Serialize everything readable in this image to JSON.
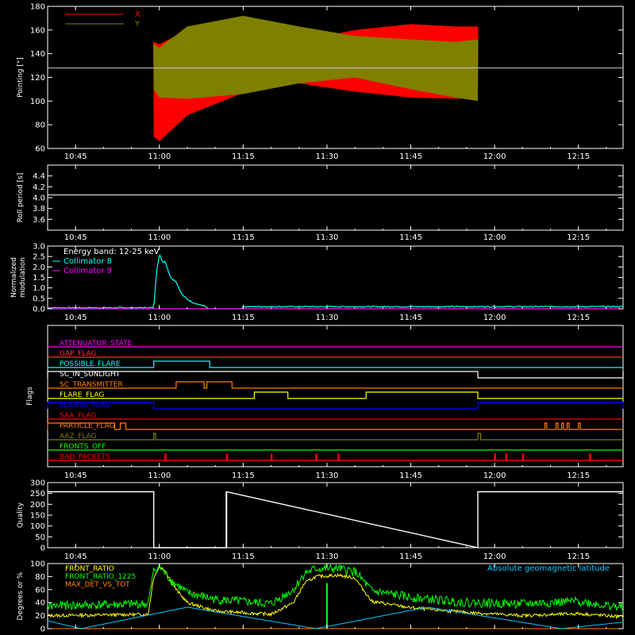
{
  "chart_data": [
    {
      "type": "line",
      "panel": "pointing",
      "ylabel": "Pointing [°]",
      "ylim": [
        60,
        180
      ],
      "yticks": [
        "60",
        "80",
        "100",
        "120",
        "140",
        "160",
        "180"
      ],
      "xticks": [
        "10:45",
        "11:00",
        "11:15",
        "11:30",
        "11:45",
        "12:00",
        "12:15"
      ],
      "legend": [
        "X",
        "Y"
      ],
      "reference_value": 128,
      "colors": {
        "X": "#ff0000",
        "Y": "#808000",
        "reference": "#c8c8c8"
      },
      "series": [
        {
          "name": "X",
          "x": [
            "10:59",
            "11:00",
            "11:05",
            "11:15",
            "11:25",
            "11:35",
            "11:45",
            "11:53",
            "11:57"
          ],
          "upper": [
            150,
            148,
            160,
            152,
            150,
            160,
            165,
            163,
            163
          ],
          "lower": [
            70,
            66,
            88,
            107,
            115,
            108,
            103,
            102,
            103
          ]
        },
        {
          "name": "Y",
          "x": [
            "10:59",
            "11:00",
            "11:05",
            "11:15",
            "11:25",
            "11:35",
            "11:45",
            "11:53",
            "11:57"
          ],
          "upper": [
            148,
            145,
            163,
            172,
            163,
            155,
            152,
            150,
            152
          ],
          "lower": [
            110,
            103,
            102,
            106,
            115,
            120,
            110,
            103,
            100
          ]
        }
      ]
    },
    {
      "type": "line",
      "panel": "roll",
      "ylabel": "Roll period [s]",
      "ylim": [
        3.4,
        4.6
      ],
      "yticks": [
        "3.6",
        "3.8",
        "4.0",
        "4.2",
        "4.4"
      ],
      "xticks": [
        "10:45",
        "11:00",
        "11:15",
        "11:30",
        "11:45",
        "12:00",
        "12:15"
      ],
      "value": 4.05
    },
    {
      "type": "line",
      "panel": "modulation",
      "ylabel": "Normalized modulation",
      "ylabel_lines": [
        "Normalized",
        "modulation"
      ],
      "ylim": [
        0,
        3
      ],
      "yticks": [
        "0.0",
        "0.5",
        "1.0",
        "1.5",
        "2.0",
        "2.5",
        "3.0"
      ],
      "xticks": [
        "10:45",
        "11:00",
        "11:15",
        "11:30",
        "11:45",
        "12:00",
        "12:15"
      ],
      "legend": [
        "Energy band: 12-25 keV",
        "Collimator 8",
        "Collimator 9"
      ],
      "colors": {
        "Collimator 8": "#00ffff",
        "Collimator 9": "#ff00ff"
      },
      "series": [
        {
          "name": "Collimator 8",
          "x": [
            "10:40",
            "10:59",
            "10:59:30",
            "11:00",
            "11:00:40",
            "11:01",
            "11:02",
            "11:03",
            "11:04",
            "11:05",
            "11:06",
            "11:07",
            "11:08",
            "11:08:40",
            "11:14:40",
            "11:15",
            "11:30",
            "11:45",
            "12:00",
            "12:15",
            "12:23"
          ],
          "y": [
            0.05,
            0.05,
            1.8,
            2.6,
            2.2,
            2.3,
            1.5,
            1.3,
            0.7,
            0.45,
            0.3,
            0.2,
            0.15,
            0.0,
            0.0,
            0.1,
            0.1,
            0.1,
            0.1,
            0.1,
            0.1
          ]
        },
        {
          "name": "Collimator 9",
          "x": [
            "10:40",
            "12:23"
          ],
          "y": [
            0.0,
            0.0
          ]
        }
      ]
    },
    {
      "type": "line",
      "panel": "flags",
      "ylabel": "Flags",
      "xticks": [
        "10:45",
        "11:00",
        "11:15",
        "11:30",
        "11:45",
        "12:00",
        "12:15"
      ],
      "flags": [
        {
          "name": "ATTENUATOR_STATE",
          "color": "#ff00ff",
          "on": []
        },
        {
          "name": "GAP_FLAG",
          "color": "#ff3030",
          "on": []
        },
        {
          "name": "POSSIBLE_FLARE",
          "color": "#00ffff",
          "on": [
            [
              "10:59",
              "11:09"
            ]
          ]
        },
        {
          "name": "SC_IN_SUNLIGHT",
          "color": "#ffffff",
          "on": [
            [
              "10:40",
              "11:57"
            ],
            [
              "12:23",
              "12:23"
            ]
          ],
          "inverted": true
        },
        {
          "name": "SC_TRANSMITTER",
          "color": "#ff8000",
          "on": [
            [
              "11:03",
              "11:08"
            ],
            [
              "11:08:30",
              "11:13"
            ]
          ]
        },
        {
          "name": "FLARE_FLAG",
          "color": "#ffff00",
          "on": [
            [
              "11:17",
              "11:23"
            ],
            [
              "11:37",
              "11:57"
            ]
          ]
        },
        {
          "name": "ECLIPSE_FLAG",
          "color": "#0000ff",
          "on": [
            [
              "10:40",
              "10:59"
            ],
            [
              "11:57",
              "12:23"
            ]
          ]
        },
        {
          "name": "SAA_FLAG",
          "color": "#ff0000",
          "on": []
        },
        {
          "name": "PARTICLE_FLAG",
          "color": "#ff8000",
          "on": [
            [
              "10:40",
              "10:52"
            ],
            [
              "10:53",
              "10:54"
            ],
            [
              "12:09",
              "12:09:20"
            ],
            [
              "12:11",
              "12:11:20"
            ],
            [
              "12:12",
              "12:12:20"
            ],
            [
              "12:13",
              "12:13:20"
            ],
            [
              "12:15",
              "12:15:20"
            ]
          ]
        },
        {
          "name": "AAZ_FLAG",
          "color": "#808000",
          "on": [
            [
              "10:59",
              "10:59:20"
            ],
            [
              "11:57",
              "11:57:30"
            ]
          ]
        },
        {
          "name": "FRONTS_OFF",
          "color": "#00ff00",
          "on": []
        },
        {
          "name": "BAD_PACKETS",
          "color": "#ff0000",
          "on": [
            [
              "11:01",
              "11:01:10"
            ],
            [
              "11:12",
              "11:12:10"
            ],
            [
              "11:20",
              "11:20:10"
            ],
            [
              "11:28",
              "11:28:10"
            ],
            [
              "11:32",
              "11:32:10"
            ],
            [
              "12:00",
              "12:00:10"
            ],
            [
              "12:02",
              "12:02:10"
            ],
            [
              "12:05",
              "12:05:10"
            ],
            [
              "12:17",
              "12:17:10"
            ]
          ]
        }
      ]
    },
    {
      "type": "line",
      "panel": "quality",
      "ylabel": "Quality",
      "ylim": [
        0,
        300
      ],
      "yticks": [
        "0",
        "50",
        "100",
        "150",
        "200",
        "250",
        "300"
      ],
      "xticks": [
        "10:45",
        "11:00",
        "11:15",
        "11:30",
        "11:45",
        "12:00",
        "12:15"
      ],
      "series": [
        {
          "name": "",
          "x": [
            "10:40",
            "10:59",
            "10:59",
            "11:12",
            "11:12",
            "11:57",
            "11:57",
            "12:23"
          ],
          "y": [
            258,
            258,
            0,
            0,
            258,
            0,
            258,
            258
          ]
        }
      ]
    },
    {
      "type": "line",
      "panel": "ratios",
      "ylabel": "Degrees or %",
      "ylim": [
        0,
        100
      ],
      "yticks": [
        "0",
        "20",
        "40",
        "60",
        "80",
        "100"
      ],
      "xticks": [
        "10:45",
        "11:00",
        "11:15",
        "11:30",
        "11:45",
        "12:00",
        "12:15"
      ],
      "legend": [
        "FRONT_RATIO",
        "FRONT_RATIO_1225",
        "MAX_DET_VS_TOT"
      ],
      "legend_right": "Absolute geomagnetic latitude",
      "colors": {
        "FRONT_RATIO": "#ffff00",
        "FRONT_RATIO_1225": "#00ff00",
        "MAX_DET_VS_TOT": "#ff8000",
        "latitude": "#00c8ff"
      },
      "series": [
        {
          "name": "FRONT_RATIO",
          "x": [
            "10:40",
            "10:58",
            "10:59",
            "11:00",
            "11:01",
            "11:03",
            "11:05",
            "11:10",
            "11:20",
            "11:24",
            "11:26",
            "11:28",
            "11:32",
            "11:35",
            "11:38",
            "11:45",
            "11:55",
            "12:05",
            "12:15",
            "12:23"
          ],
          "y": [
            20,
            22,
            80,
            95,
            90,
            60,
            40,
            27,
            22,
            40,
            70,
            80,
            82,
            78,
            42,
            32,
            25,
            20,
            23,
            18
          ]
        },
        {
          "name": "FRONT_RATIO_1225",
          "x": [
            "10:40",
            "10:58",
            "10:59",
            "11:00",
            "11:02",
            "11:05",
            "11:10",
            "11:20",
            "11:24",
            "11:26",
            "11:28",
            "11:32",
            "11:35",
            "11:38",
            "11:45",
            "11:55",
            "12:05",
            "12:15",
            "12:23"
          ],
          "y": [
            35,
            38,
            90,
            95,
            75,
            55,
            45,
            38,
            60,
            85,
            92,
            92,
            88,
            58,
            48,
            40,
            38,
            42,
            32
          ]
        },
        {
          "name": "MAX_DET_VS_TOT",
          "x": [
            "10:40",
            "12:23"
          ],
          "y": [
            0,
            0
          ]
        },
        {
          "name": "Absolute geomagnetic latitude",
          "x": [
            "10:40",
            "10:46",
            "11:05",
            "11:28",
            "11:48",
            "12:12",
            "12:23"
          ],
          "y": [
            12,
            0,
            33,
            0,
            33,
            0,
            10
          ]
        }
      ]
    }
  ]
}
